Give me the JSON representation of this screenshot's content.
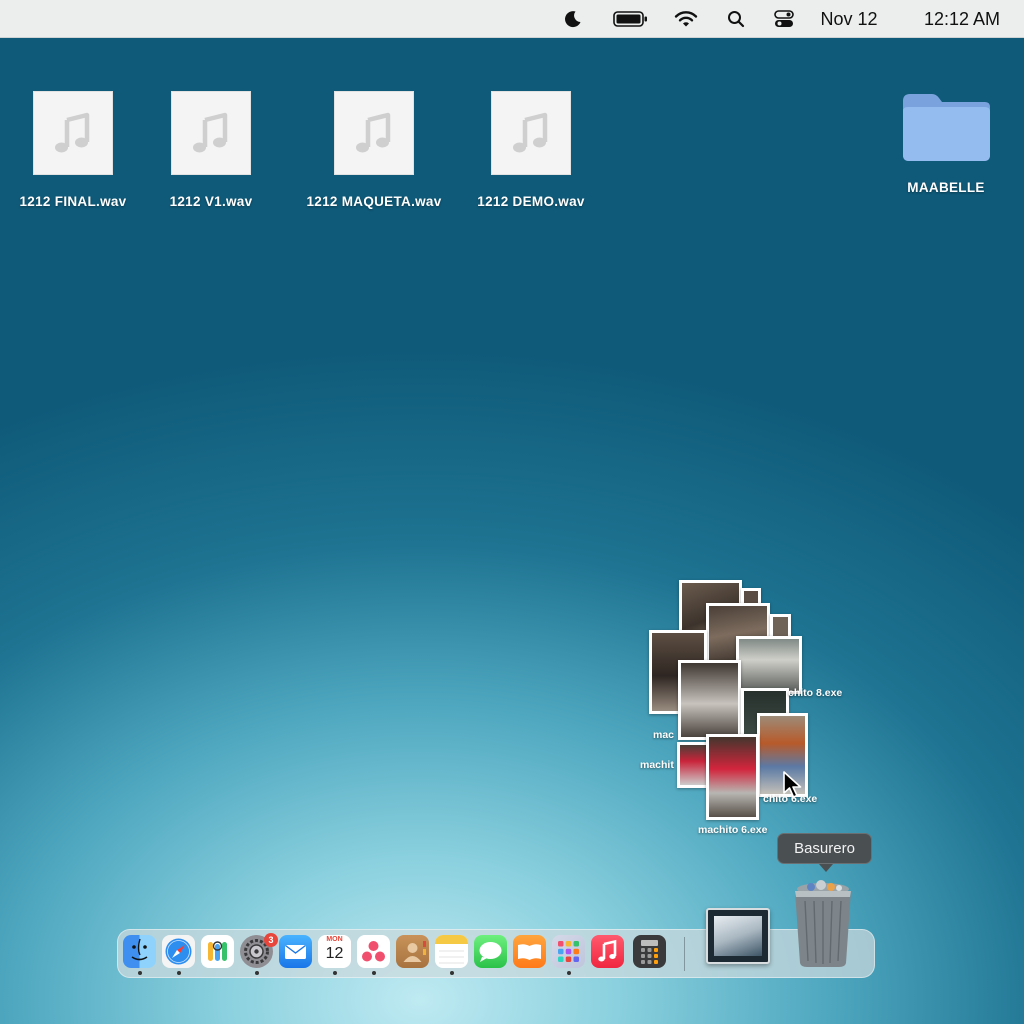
{
  "menubar": {
    "date": "Nov 12",
    "time": "12:12 AM",
    "icons": [
      "moon-icon",
      "battery-icon",
      "wifi-icon",
      "search-icon",
      "control-center-icon"
    ]
  },
  "desktop": {
    "files": [
      {
        "name": "1212 FINAL.wav",
        "icon": "audio-file-icon"
      },
      {
        "name": "1212 V1.wav",
        "icon": "audio-file-icon"
      },
      {
        "name": "1212 MAQUETA.wav",
        "icon": "audio-file-icon"
      },
      {
        "name": "1212 DEMO.wav",
        "icon": "audio-file-icon"
      }
    ],
    "folder": {
      "name": "MAABELLE",
      "icon": "folder-icon",
      "color": "#8fb6ea"
    },
    "photo_pile_labels": [
      "chito 8.exe",
      "mac",
      "machit",
      "chito 6.exe",
      "machito 6.exe"
    ]
  },
  "tooltip": {
    "text": "Basurero"
  },
  "dock": {
    "apps": [
      "finder",
      "safari",
      "passwords",
      "system-settings",
      "mail",
      "calendar",
      "asana",
      "contacts",
      "notes",
      "messages",
      "books",
      "launchpad",
      "music",
      "calculator"
    ],
    "calendar_month": "MON",
    "calendar_day": "12",
    "settings_badge": "3",
    "trash_label": "Basurero"
  },
  "colors": {
    "desktop_top": "#0f5a79",
    "desktop_glow": "#bfeaf2",
    "menubar_bg": "#eceeee",
    "badge": "#e8463a"
  }
}
